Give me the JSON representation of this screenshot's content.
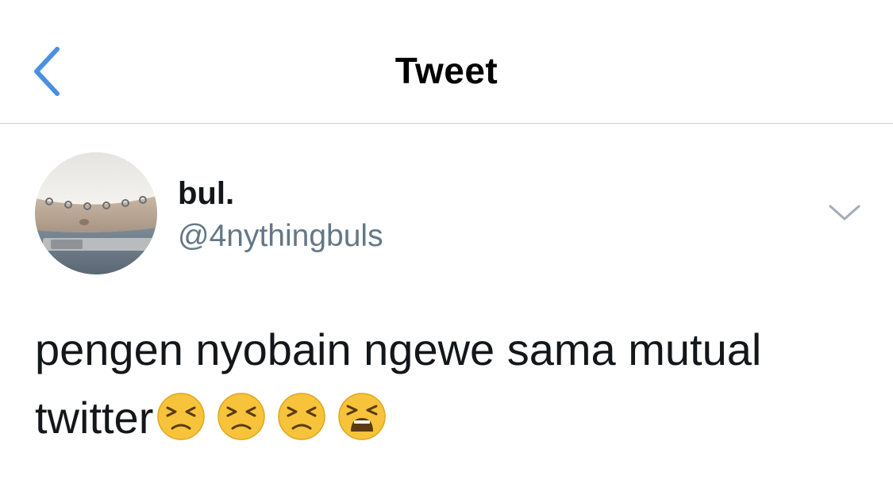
{
  "nav": {
    "title": "Tweet",
    "back_icon": "chevron-left-icon",
    "accent_color": "#4a90e2"
  },
  "tweet": {
    "author": {
      "display_name": "bul.",
      "handle": "@4nythingbuls",
      "avatar_icon": "avatar-photo"
    },
    "more_icon": "chevron-down-icon",
    "text_main": "pengen nyobain ngewe sama mutual twitter",
    "emojis": [
      {
        "name": "persevering-face-emoji"
      },
      {
        "name": "persevering-face-emoji"
      },
      {
        "name": "persevering-face-emoji"
      },
      {
        "name": "weary-face-emoji"
      }
    ]
  },
  "colors": {
    "text_primary": "#14171a",
    "text_secondary": "#657786",
    "divider": "#d0d0d4"
  }
}
